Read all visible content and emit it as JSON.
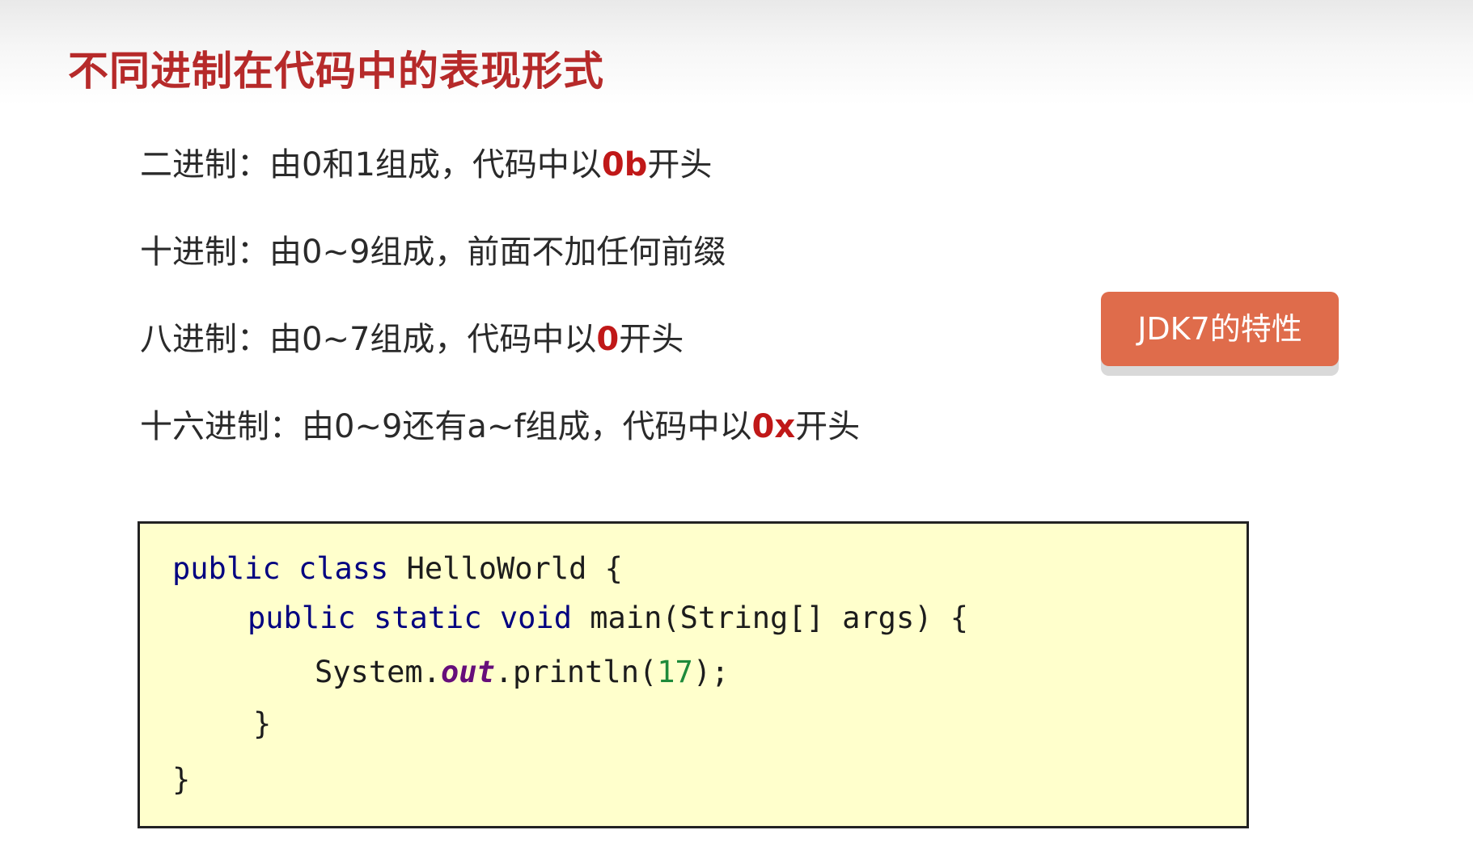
{
  "slide": {
    "title": "不同进制在代码中的表现形式"
  },
  "rules": [
    {
      "before": "二进制：由0和1组成，代码中以",
      "prefix": "0b",
      "after": "开头"
    },
    {
      "before": "十进制：由0~9组成，前面不加任何前缀",
      "prefix": "",
      "after": ""
    },
    {
      "before": "八进制：由0~7组成，代码中以",
      "prefix": "0",
      "after": "开头"
    },
    {
      "before": "十六进制：由0~9还有a~f组成，代码中以",
      "prefix": "0x",
      "after": "开头"
    }
  ],
  "badge": {
    "label": "JDK7的特性"
  },
  "code": {
    "line1": {
      "kw1": "public",
      "kw2": "class",
      "rest": "HelloWorld {"
    },
    "line2": {
      "kw1": "public",
      "kw2": "static",
      "kw3": "void",
      "rest": "main(String[] args) {"
    },
    "line3": {
      "obj": "System.",
      "field": "out",
      "method": ".println(",
      "num": "17",
      "end": ");"
    },
    "line4": {
      "brace": "}"
    },
    "line5": {
      "brace": "}"
    }
  },
  "colors": {
    "title": "#b62a2a",
    "prefix": "#c01818",
    "badge_bg": "#df6c4b",
    "code_bg": "#ffffcc",
    "keyword": "#000080",
    "static_field": "#660e7a",
    "number": "#1e8a3a"
  }
}
